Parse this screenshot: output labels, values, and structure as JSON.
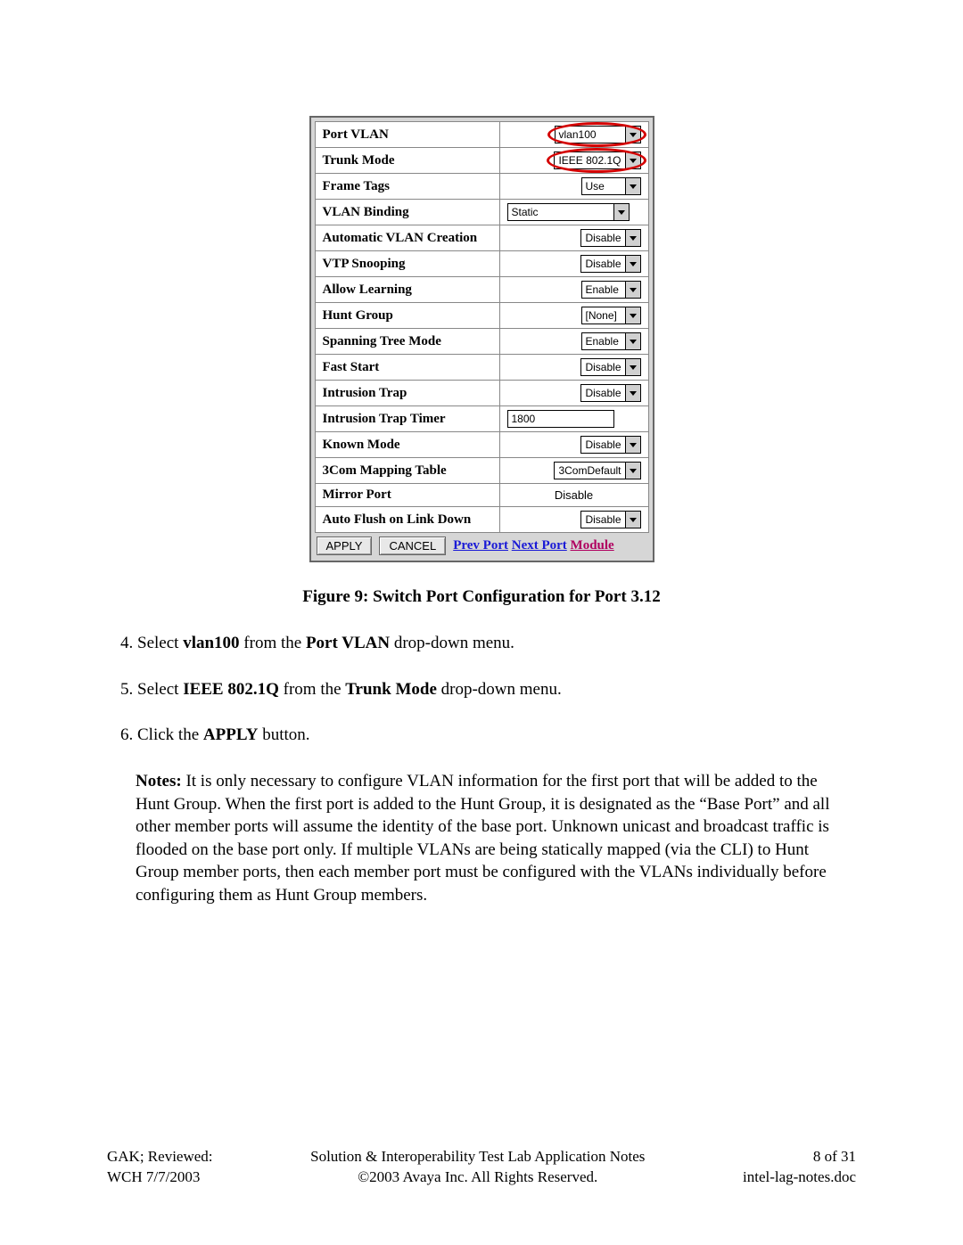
{
  "panel": {
    "rows": [
      {
        "label": "Port VLAN",
        "value": "vlan100",
        "kind": "dropdown",
        "width": "med",
        "circled": true
      },
      {
        "label": "Trunk Mode",
        "value": "IEEE 802.1Q",
        "kind": "dropdown",
        "width": "med",
        "circled": true
      },
      {
        "label": "Frame Tags",
        "value": "Use",
        "kind": "dropdown",
        "width": ""
      },
      {
        "label": "VLAN Binding",
        "value": "Static",
        "kind": "dropdown",
        "width": "wide",
        "align": "left"
      },
      {
        "label": "Automatic VLAN Creation",
        "value": "Disable",
        "kind": "dropdown",
        "width": ""
      },
      {
        "label": "VTP Snooping",
        "value": "Disable",
        "kind": "dropdown",
        "width": ""
      },
      {
        "label": "Allow Learning",
        "value": "Enable",
        "kind": "dropdown",
        "width": ""
      },
      {
        "label": "Hunt Group",
        "value": "[None]",
        "kind": "dropdown",
        "width": ""
      },
      {
        "label": "Spanning Tree Mode",
        "value": "Enable",
        "kind": "dropdown",
        "width": ""
      },
      {
        "label": "Fast Start",
        "value": "Disable",
        "kind": "dropdown",
        "width": ""
      },
      {
        "label": "Intrusion Trap",
        "value": "Disable",
        "kind": "dropdown",
        "width": ""
      },
      {
        "label": "Intrusion Trap Timer",
        "value": "1800",
        "kind": "textbox",
        "width": "wide",
        "align": "left"
      },
      {
        "label": "Known Mode",
        "value": "Disable",
        "kind": "dropdown",
        "width": ""
      },
      {
        "label": "3Com Mapping Table",
        "value": "3ComDefault",
        "kind": "dropdown",
        "width": "med"
      },
      {
        "label": "Mirror Port",
        "value": "Disable",
        "kind": "text",
        "align": "center"
      },
      {
        "label": "Auto Flush on Link Down",
        "value": "Disable",
        "kind": "dropdown",
        "width": ""
      }
    ],
    "buttons": {
      "apply": "APPLY",
      "cancel": "CANCEL"
    },
    "nav": {
      "prev": "Prev Port",
      "next": "Next Port",
      "module": "Module"
    }
  },
  "caption": "Figure 9: Switch Port Configuration for Port 3.12",
  "steps": {
    "start": 4,
    "items": [
      {
        "pre": "Select ",
        "b1": "vlan100",
        "mid": " from the ",
        "b2": "Port VLAN",
        "post": " drop-down menu."
      },
      {
        "pre": "Select ",
        "b1": "IEEE 802.1Q",
        "mid": " from the ",
        "b2": "Trunk Mode",
        "post": " drop-down menu."
      },
      {
        "pre": "Click the ",
        "b1": "APPLY",
        "mid": "",
        "b2": "",
        "post": " button."
      }
    ]
  },
  "notes": {
    "label": "Notes:",
    "text": " It is only necessary to configure VLAN information for the first port that will be added to the Hunt Group.  When the first port is added to the Hunt Group, it is designated as the “Base Port” and all other member ports will assume the identity of the base port.  Unknown unicast and broadcast traffic is flooded on the base port only.  If multiple VLANs are being statically mapped (via the CLI) to Hunt Group member ports, then each member port must be configured with the VLANs individually before configuring them as Hunt Group members."
  },
  "footer": {
    "left1": "GAK; Reviewed:",
    "left2": "WCH 7/7/2003",
    "mid1": "Solution & Interoperability Test Lab Application Notes",
    "mid2": "©2003 Avaya Inc. All Rights Reserved.",
    "right1": "8 of 31",
    "right2": "intel-lag-notes.doc"
  }
}
